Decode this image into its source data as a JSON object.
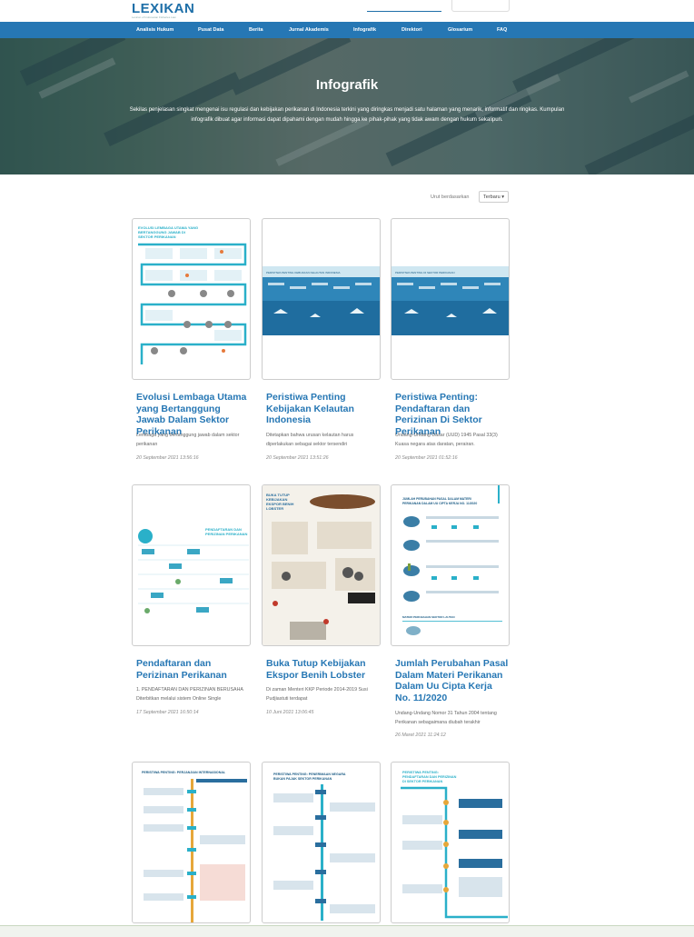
{
  "site": {
    "logo": "LEXIKAN",
    "logo_tagline": "Lexicon of Indonesian Fisheries Law"
  },
  "nav": {
    "items": [
      "Analisis Hukum",
      "Pusat Data",
      "Berita",
      "Jurnal Akademis",
      "Infografik",
      "Direktori",
      "Glosarium",
      "FAQ"
    ]
  },
  "hero": {
    "title": "Infografik",
    "description": "Sekilas penjelasan singkat mengenai isu regulasi dan kebijakan perikanan di Indonesia terkini yang diringkas menjadi satu halaman yang menarik, informatif dan ringkas. Kumpulan infografik dibuat agar informasi dapat dipahami dengan mudah hingga ke pihak-pihak yang tidak awam dengan hukum sekalipun."
  },
  "sort": {
    "label": "Urut berdasarkan",
    "selected": "Terbaru"
  },
  "cards": [
    {
      "title": "Evolusi Lembaga Utama yang Bertanggung Jawab Dalam Sektor Perikanan",
      "desc": "Lembaga yang bertanggung jawab dalam sektor perikanan",
      "date": "20 September 2021 13:56:16",
      "thumb_heading": "EVOLUSI LEMBAGA UTAMA YANG BERTANGGUNG JAWAB DI SEKTOR PERIKANAN"
    },
    {
      "title": "Peristiwa Penting Kebijakan Kelautan Indonesia",
      "desc": "Ditetapkan bahwa urusan kelautan harus diperlakukan sebagai sektor tersendiri",
      "date": "20 September 2021 13:51:26",
      "thumb_heading": "PERISTIWA PENTING KEBIJAKAN KELAUTAN INDONESIA"
    },
    {
      "title": "Peristiwa Penting: Pendaftaran dan Perizinan Di Sektor Perikanan",
      "desc": "Undang-Undang Dasar (UUD) 1945 Pasal 33(3) Kuasa negara atas daratan, perairan.",
      "date": "20 September 2021 01:52:16",
      "thumb_heading": "PERISTIWA PENTING DI SEKTOR PERIKANAN"
    },
    {
      "title": "Pendaftaran dan Perizinan Perikanan",
      "desc": "1. PENDAFTARAN DAN PERIZINAN BERUSAHA Diterbitkan melalui sistem Online Single",
      "date": "17 September 2021 16:50:14",
      "thumb_heading": "PENDAFTARAN DAN PERIZINAN PERIKANAN"
    },
    {
      "title": "Buka Tutup Kebijakan Ekspor Benih Lobster",
      "desc": "Di zaman Menteri KKP Periode 2014-2019 Susi Pudjiastuti terdapat",
      "date": "10 Juni 2021 13:06:45",
      "thumb_heading": "BUKA TUTUP KEBIJAKAN EKSPOR BENIH LOBSTER"
    },
    {
      "title": "Jumlah Perubahan Pasal Dalam Materi Perikanan Dalam Uu Cipta Kerja No. 11/2020",
      "desc": "Undang-Undang Nomor 31 Tahun 2004 tentang Perikanan sebagaimana diubah terakhir",
      "date": "26 Maret 2021 11:24:12",
      "thumb_heading": "JUMLAH PERUBAHAN PASAL DALAM MATERI PERIKANAN DALAM UU CIPTA KERJA NO. 11/2020"
    },
    {
      "title": "",
      "desc": "",
      "date": "",
      "thumb_heading": "PERISTIWA PENTING: PERJANJIAN INTERNASIONAL"
    },
    {
      "title": "",
      "desc": "",
      "date": "",
      "thumb_heading": "PERISTIWA PENTING: PENERIMAAN NEGARA BUKAN PAJAK SEKTOR PERIKANAN"
    },
    {
      "title": "",
      "desc": "",
      "date": "",
      "thumb_heading": "PERISTIWA PENTING: PENDAFTARAN DAN PERIZINAN DI SEKTOR PERIKANAN"
    }
  ],
  "colors": {
    "brand": "#2677b4",
    "nav_bg": "#2677b4",
    "title": "#2677b4",
    "accent_teal": "#2ab0c9"
  }
}
